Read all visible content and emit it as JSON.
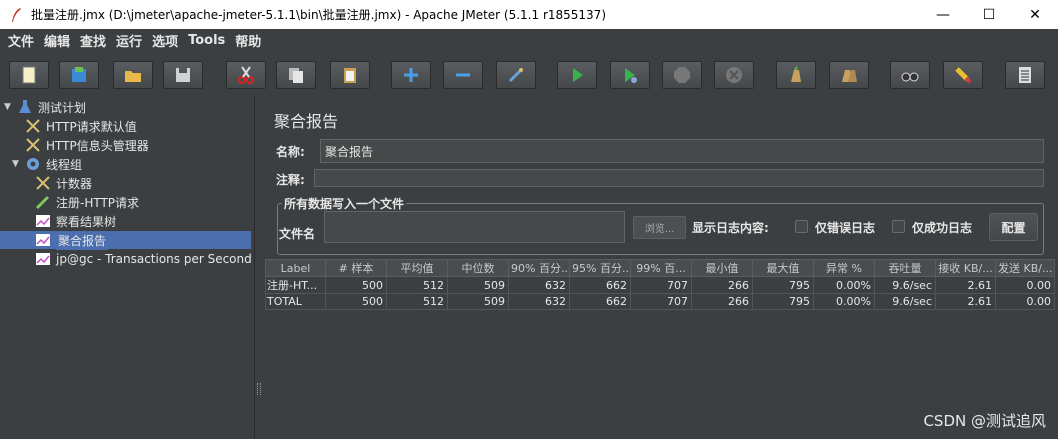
{
  "window": {
    "title": "批量注册.jmx (D:\\jmeter\\apache-jmeter-5.1.1\\bin\\批量注册.jmx) - Apache JMeter (5.1.1 r1855137)",
    "minimize": "—",
    "maximize": "☐",
    "close": "✕"
  },
  "menu": [
    "文件",
    "编辑",
    "查找",
    "运行",
    "选项",
    "Tools",
    "帮助"
  ],
  "toolbar": [
    {
      "name": "new-icon"
    },
    {
      "name": "templates-icon"
    },
    {
      "name": "open-icon"
    },
    {
      "name": "save-icon"
    },
    {
      "name": "cut-icon"
    },
    {
      "name": "copy-icon"
    },
    {
      "name": "paste-icon"
    },
    {
      "name": "expand-icon"
    },
    {
      "name": "collapse-icon"
    },
    {
      "name": "toggle-icon"
    },
    {
      "name": "start-icon"
    },
    {
      "name": "start-no-pauses-icon"
    },
    {
      "name": "stop-icon"
    },
    {
      "name": "shutdown-icon"
    },
    {
      "name": "clear-icon"
    },
    {
      "name": "clear-all-icon"
    },
    {
      "name": "search-icon"
    },
    {
      "name": "reset-search-icon"
    },
    {
      "name": "function-helper-icon"
    }
  ],
  "tree": [
    {
      "label": "测试计划",
      "icon": "flask-icon",
      "level": 0,
      "expanded": true
    },
    {
      "label": "HTTP请求默认值",
      "icon": "wrench-icon",
      "level": 1
    },
    {
      "label": "HTTP信息头管理器",
      "icon": "wrench-icon",
      "level": 1
    },
    {
      "label": "线程组",
      "icon": "gear-icon",
      "level": 1,
      "expanded": true
    },
    {
      "label": "计数器",
      "icon": "wrench-icon",
      "level": 2
    },
    {
      "label": "注册-HTTP请求",
      "icon": "pen-icon",
      "level": 2
    },
    {
      "label": "察看结果树",
      "icon": "chart-icon",
      "level": 2
    },
    {
      "label": "聚合报告",
      "icon": "chart-icon",
      "level": 2,
      "selected": true
    },
    {
      "label": "jp@gc - Transactions per Second",
      "icon": "chart-icon",
      "level": 2
    }
  ],
  "panel": {
    "title": "聚合报告",
    "name_label": "名称:",
    "name_value": "聚合报告",
    "comment_label": "注释:",
    "comment_value": "",
    "file_group_legend": "所有数据写入一个文件",
    "file_label": "文件名",
    "file_value": "",
    "browse_label": "浏览...",
    "log_label": "显示日志内容:",
    "errors_only_label": "仅错误日志",
    "success_only_label": "仅成功日志",
    "config_label": "配置"
  },
  "table": {
    "columns": [
      "Label",
      "# 样本",
      "平均值",
      "中位数",
      "90% 百分...",
      "95% 百分...",
      "99% 百...",
      "最小值",
      "最大值",
      "异常 %",
      "吞吐量",
      "接收 KB/...",
      "发送 KB/..."
    ],
    "rows": [
      [
        "注册-HT...",
        "500",
        "512",
        "509",
        "632",
        "662",
        "707",
        "266",
        "795",
        "0.00%",
        "9.6/sec",
        "2.61",
        "0.00"
      ],
      [
        "TOTAL",
        "500",
        "512",
        "509",
        "632",
        "662",
        "707",
        "266",
        "795",
        "0.00%",
        "9.6/sec",
        "2.61",
        "0.00"
      ]
    ]
  },
  "watermark": "CSDN @测试追风"
}
